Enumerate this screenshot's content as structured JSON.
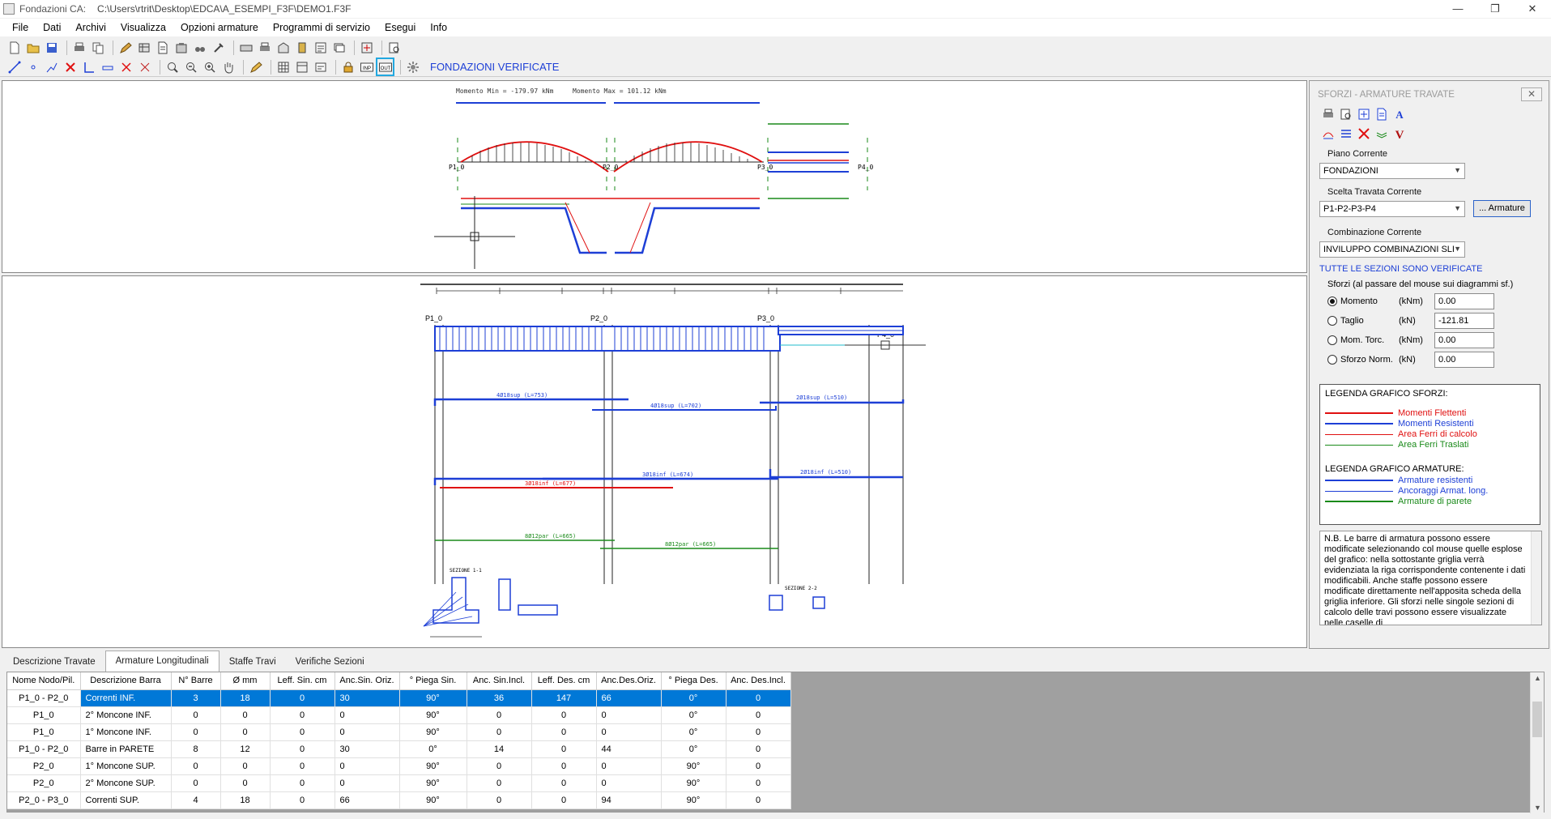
{
  "window": {
    "app_title": "Fondazioni CA:",
    "file_path": "C:\\Users\\rtrit\\Desktop\\EDCA\\A_ESEMPI_F3F\\DEMO1.F3F"
  },
  "menu": [
    "File",
    "Dati",
    "Archivi",
    "Visualizza",
    "Opzioni armature",
    "Programmi di servizio",
    "Esegui",
    "Info"
  ],
  "toolbar2": {
    "status": "FONDAZIONI VERIFICATE",
    "inp_label": "INP",
    "out_label": "OUT"
  },
  "diagram_top": {
    "momento_min": "Momento Min = -179.97 kNm",
    "momento_max": "Momento Max = 101.12 kNm",
    "nodes": [
      "P1_0",
      "P2_0",
      "P3_0",
      "P4_0"
    ]
  },
  "diagram_mid": {
    "nodes": [
      "P1_0",
      "P2_0",
      "P3_0",
      "P4_0"
    ],
    "bars": [
      "4Ø18sup (L=753)",
      "4Ø18sup (L=702)",
      "2Ø18sup (L=510)",
      "3Ø18inf (L=677)",
      "2Ø18inf (L=510)",
      "3Ø18inf (L=674)",
      "8Ø12par (L=665)",
      "8Ø12par (L=665)"
    ],
    "sections": [
      "SEZIONE 1-1",
      "SEZIONE 2-2"
    ]
  },
  "colors": {
    "accent_blue": "#1d3fd6",
    "red": "#e01010",
    "green": "#1a8a1a",
    "selection": "#0078d7"
  },
  "right_panel": {
    "title": "SFORZI - ARMATURE TRAVATE",
    "piano_label": "Piano Corrente",
    "piano_value": "FONDAZIONI",
    "travata_label": "Scelta Travata Corrente",
    "travata_value": "P1-P2-P3-P4",
    "armature_button": "... Armature",
    "combinazione_label": "Combinazione Corrente",
    "combinazione_value": "INVILUPPO COMBINAZIONI  SLI",
    "ok_message": "TUTTE LE SEZIONI SONO VERIFICATE",
    "sforzi_title": "Sforzi  (al passare del mouse sui diagrammi sf.)",
    "sforzi": [
      {
        "name": "Momento",
        "unit": "(kNm)",
        "value": "0.00",
        "selected": true
      },
      {
        "name": "Taglio",
        "unit": "(kN)",
        "value": "-121.81",
        "selected": false
      },
      {
        "name": "Mom. Torc.",
        "unit": "(kNm)",
        "value": "0.00",
        "selected": false
      },
      {
        "name": "Sforzo Norm.",
        "unit": "(kN)",
        "value": "0.00",
        "selected": false
      }
    ],
    "legend_sforzi_title": "LEGENDA GRAFICO SFORZI:",
    "legend_sforzi": [
      {
        "label": "Momenti Flettenti",
        "color": "#e01010",
        "thick": true
      },
      {
        "label": "Momenti Resistenti",
        "color": "#1d3fd6",
        "thick": true
      },
      {
        "label": "Area Ferri di calcolo",
        "color": "#e01010",
        "thick": false
      },
      {
        "label": "Area Ferri Traslati",
        "color": "#1a8a1a",
        "thick": false
      }
    ],
    "legend_armature_title": "LEGENDA GRAFICO ARMATURE:",
    "legend_armature": [
      {
        "label": "Armature resistenti",
        "color": "#1d3fd6",
        "thick": true
      },
      {
        "label": "Ancoraggi Armat. long.",
        "color": "#1d3fd6",
        "thick": false
      },
      {
        "label": "Armature di parete",
        "color": "#1a8a1a",
        "thick": true
      }
    ],
    "note": "N.B. Le barre di armatura possono essere modificate selezionando col mouse quelle esplose del grafico: nella sottostante griglia verrà evidenziata la riga corrispondente contenente i dati modificabili. Anche staffe possono essere modificate direttamente nell'apposita scheda della griglia inferiore. Gli sforzi nelle singole sezioni di calcolo delle travi possono essere visualizzate nelle caselle di"
  },
  "tabs": [
    "Descrizione Travate",
    "Armature Longitudinali",
    "Staffe Travi",
    "Verifiche Sezioni"
  ],
  "grid": {
    "headers": [
      "Nome Nodo/Pil.",
      "Descrizione Barra",
      "N° Barre",
      "Ø mm",
      "Leff. Sin. cm",
      "Anc.Sin. Oriz.",
      "° Piega Sin.",
      "Anc. Sin.Incl.",
      "Leff. Des. cm",
      "Anc.Des.Oriz.",
      "° Piega Des.",
      "Anc. Des.Incl."
    ],
    "rows": [
      [
        "P1_0 - P2_0",
        "Correnti  INF.",
        "3",
        "18",
        "0",
        "30",
        "90°",
        "36",
        "147",
        "66",
        "0°",
        "0"
      ],
      [
        "P1_0",
        "2° Moncone  INF.",
        "0",
        "0",
        "0",
        "0",
        "90°",
        "0",
        "0",
        "0",
        "0°",
        "0"
      ],
      [
        "P1_0",
        "1° Moncone  INF.",
        "0",
        "0",
        "0",
        "0",
        "90°",
        "0",
        "0",
        "0",
        "0°",
        "0"
      ],
      [
        "P1_0 - P2_0",
        "Barre in PARETE",
        "8",
        "12",
        "0",
        "30",
        "0°",
        "14",
        "0",
        "44",
        "0°",
        "0"
      ],
      [
        "P2_0",
        "1° Moncone SUP.",
        "0",
        "0",
        "0",
        "0",
        "90°",
        "0",
        "0",
        "0",
        "90°",
        "0"
      ],
      [
        "P2_0",
        "2° Moncone SUP.",
        "0",
        "0",
        "0",
        "0",
        "90°",
        "0",
        "0",
        "0",
        "90°",
        "0"
      ],
      [
        "P2_0 - P3_0",
        "Correnti SUP.",
        "4",
        "18",
        "0",
        "66",
        "90°",
        "0",
        "0",
        "94",
        "90°",
        "0"
      ]
    ]
  }
}
